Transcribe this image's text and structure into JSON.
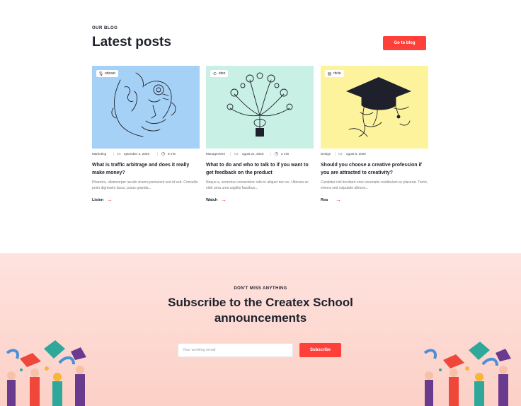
{
  "blog": {
    "eyebrow": "OUR BLOG",
    "title": "Latest posts",
    "go_button": "Go to blog",
    "posts": [
      {
        "tag": "odcast",
        "tag_icon": "microphone-icon",
        "category": "Marketing",
        "date": "eptember 4, 2020",
        "duration": "8 min",
        "title": "What is traffic arbitrage and does it really make money?",
        "excerpt": "Pharetra, ullamcorper iaculis viverra parturient sed id sed. Convallis proin dignissim lacus, purus gravida...",
        "cta": "Listen",
        "bg": "#a6d1f7"
      },
      {
        "tag": "ideo",
        "tag_icon": "play-icon",
        "category": "Management",
        "date": "ugust 21, 2020",
        "duration": "3 min",
        "title": "What to do and who to talk to if you want to get feedback on the product",
        "excerpt": "Neque a, senectus consectetur odio in aliquet nec eu. Ultricies ac nibh urna urna sagittis faucibus...",
        "cta": "Watch",
        "bg": "#c8f0e4"
      },
      {
        "tag": "rticle",
        "tag_icon": "file-icon",
        "category": "Design",
        "date": "ugust 8, 2020",
        "duration": "",
        "title": "Should you choose a creative profession if you are attracted to creativity?",
        "excerpt": "Curabitur nisl tincidunt eros venenatis vestibulum ac placerat. Tortor, viverra sed vulputate ultrices...",
        "cta": "Rea",
        "bg": "#fdf39c"
      }
    ]
  },
  "subscribe": {
    "eyebrow": "DON'T MISS ANYTHING",
    "title": "Subscribe to the Createx School announcements",
    "email_placeholder": "Your working email",
    "button": "Subscribe"
  },
  "colors": {
    "accent": "#ff3f3a",
    "text": "#1e212c",
    "muted": "#787a80",
    "subscribe_bg": "#fcd6ce"
  }
}
